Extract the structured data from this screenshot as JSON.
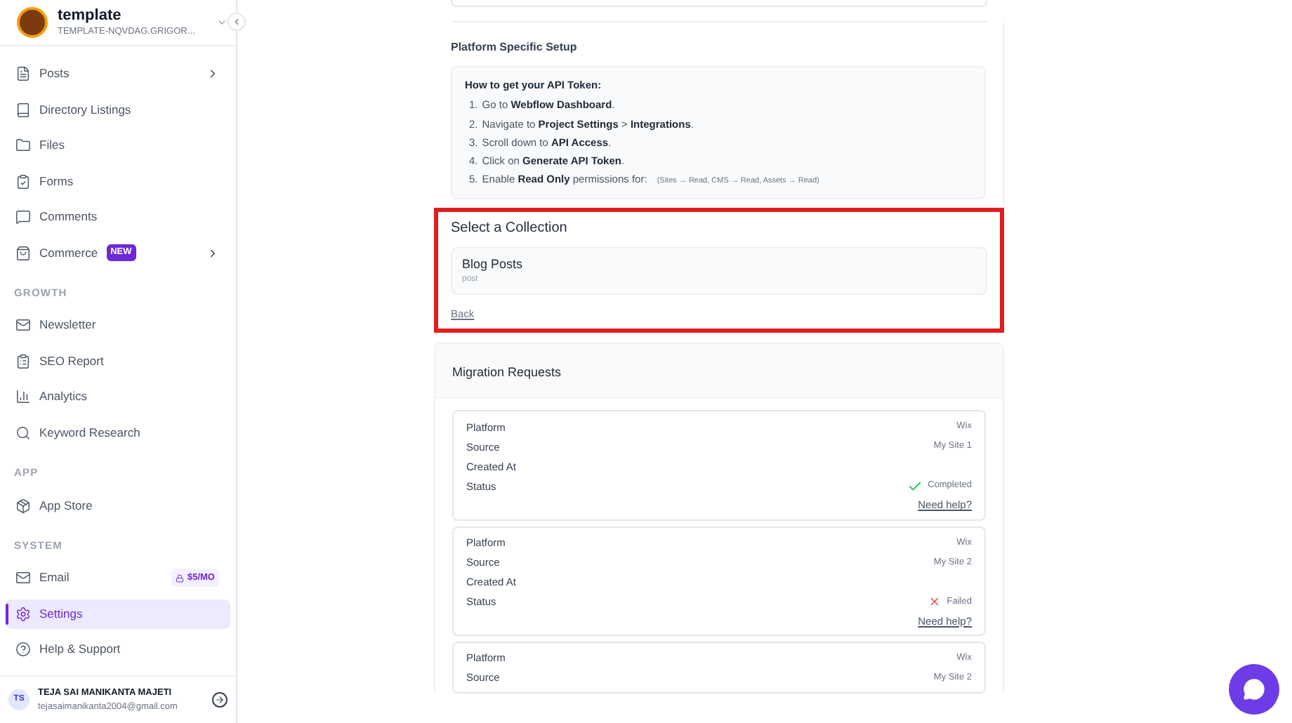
{
  "sidebar": {
    "workspace": {
      "name": "template",
      "subtitle": "TEMPLATE-NQVDAG.GRIGOR..."
    },
    "sections": [
      {
        "items": [
          {
            "label": "Posts",
            "selected": false,
            "has_submenu": true
          },
          {
            "label": "Directory Listings",
            "selected": false,
            "has_submenu": false
          },
          {
            "label": "Files",
            "selected": false,
            "has_submenu": false
          },
          {
            "label": "Forms",
            "selected": false,
            "has_submenu": false
          },
          {
            "label": "Comments",
            "selected": false,
            "has_submenu": false
          },
          {
            "label": "Commerce",
            "selected": false,
            "has_submenu": true,
            "badge": "NEW"
          }
        ]
      },
      {
        "heading": "GROWTH",
        "items": [
          {
            "label": "Newsletter",
            "selected": false,
            "has_submenu": false
          },
          {
            "label": "SEO Report",
            "selected": false,
            "has_submenu": false
          },
          {
            "label": "Analytics",
            "selected": false,
            "has_submenu": false
          },
          {
            "label": "Keyword Research",
            "selected": false,
            "has_submenu": false
          }
        ]
      },
      {
        "heading": "APP",
        "items": [
          {
            "label": "App Store",
            "selected": false,
            "has_submenu": false
          }
        ]
      },
      {
        "heading": "SYSTEM",
        "items": [
          {
            "label": "Email",
            "selected": false,
            "has_submenu": false,
            "price": "$5/MO"
          },
          {
            "label": "Settings",
            "selected": true,
            "has_submenu": false
          },
          {
            "label": "Help & Support",
            "selected": false,
            "has_submenu": false
          }
        ]
      }
    ],
    "user": {
      "initials": "TS",
      "name": "TEJA SAI MANIKANTA MAJETI",
      "email": "tejasaimanikanta2004@gmail.com"
    }
  },
  "setup": {
    "title": "Platform Specific Setup",
    "instructions_title": "How to get your API Token:",
    "steps": [
      {
        "number": "1.",
        "text": "Go to **Webflow Dashboard**."
      },
      {
        "number": "2.",
        "text": "Navigate to **Project Settings** > **Integrations**."
      },
      {
        "number": "3.",
        "text": "Scroll down to **API Access**."
      },
      {
        "number": "4.",
        "text": "Click on **Generate API Token**."
      },
      {
        "number": "5.",
        "text": "Enable **Read Only** permissions for:",
        "note": "(Sites → Read, CMS → Read, Assets → Read)"
      }
    ]
  },
  "collection": {
    "title": "Select a Collection",
    "items": [
      {
        "name": "Blog Posts",
        "slug": "post"
      }
    ],
    "back_link": "Back"
  },
  "migrations": {
    "title": "Migration Requests",
    "requests": [
      {
        "rows": [
          {
            "label": "Platform",
            "value": "Wix"
          },
          {
            "label": "Source",
            "value": "My Site 1"
          },
          {
            "label": "Created At",
            "value": ""
          }
        ],
        "status": {
          "label": "Status",
          "value": "Completed",
          "kind": "completed"
        },
        "help_link": "Need help?"
      },
      {
        "rows": [
          {
            "label": "Platform",
            "value": "Wix"
          },
          {
            "label": "Source",
            "value": "My Site 2"
          },
          {
            "label": "Created At",
            "value": ""
          }
        ],
        "status": {
          "label": "Status",
          "value": "Failed",
          "kind": "failed"
        },
        "help_link": "Need help?"
      },
      {
        "rows": [
          {
            "label": "Platform",
            "value": "Wix"
          },
          {
            "label": "Source",
            "value": "My Site 2"
          }
        ]
      }
    ]
  }
}
